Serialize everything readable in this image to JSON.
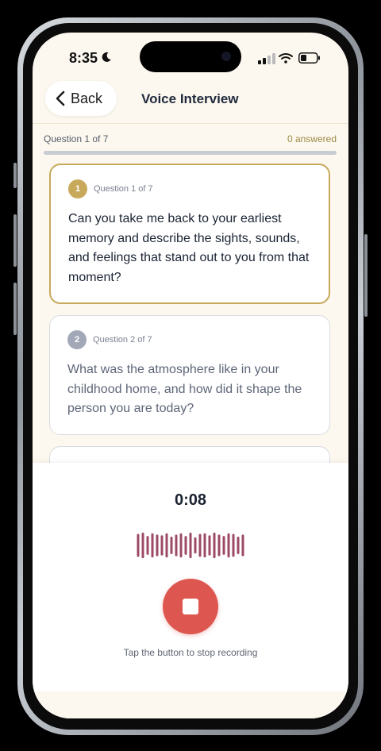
{
  "status_bar": {
    "time": "8:35",
    "icons": [
      "moon-icon",
      "signal-icon",
      "wifi-icon",
      "battery-icon"
    ]
  },
  "header": {
    "back_label": "Back",
    "title": "Voice Interview"
  },
  "progress": {
    "label": "Question 1 of 7",
    "answered": "0 answered",
    "fraction": 0
  },
  "questions": [
    {
      "number": "1",
      "meta": "Question 1 of 7",
      "text": "Can you take me back to your earliest memory and describe the sights, sounds, and feelings that stand out to you from that moment?",
      "state": "active"
    },
    {
      "number": "2",
      "meta": "Question 2 of 7",
      "text": "What was the atmosphere like in your childhood home, and how did it shape the person you are today?",
      "state": "inactive"
    }
  ],
  "recorder": {
    "timer": "0:08",
    "hint": "Tap the button to stop recording",
    "waveform_levels": [
      0.85,
      0.95,
      0.7,
      0.9,
      0.8,
      0.75,
      0.9,
      0.65,
      0.8,
      0.9,
      0.7,
      0.95,
      0.6,
      0.85,
      0.9,
      0.75,
      0.95,
      0.8,
      0.7,
      0.9,
      0.85,
      0.65,
      0.8
    ]
  },
  "colors": {
    "accent_gold": "#c8a95c",
    "badge_inactive": "#a3a8b8",
    "stop_red": "#de5650",
    "wave": "#9c4a65",
    "background": "#fdf8ef"
  }
}
